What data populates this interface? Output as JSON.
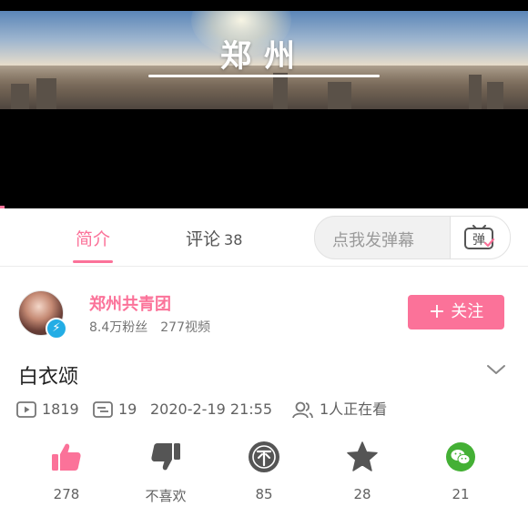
{
  "banner": {
    "title": "郑州"
  },
  "tabs": {
    "intro": "简介",
    "comments": "评论",
    "comments_count": "38"
  },
  "danmu": {
    "placeholder": "点我发弹幕",
    "button_glyph": "弹"
  },
  "uploader": {
    "name": "郑州共青团",
    "fans": "8.4万粉丝",
    "videos": "277视频",
    "follow_label": "关注",
    "follow_plus": "+"
  },
  "video": {
    "title": "白衣颂",
    "plays": "1819",
    "danmaku": "19",
    "date": "2020-2-19 21:55",
    "watching": "1人正在看"
  },
  "actions": [
    {
      "icon": "thumbs-up-icon",
      "label": "278",
      "color": "#fb7299"
    },
    {
      "icon": "thumbs-down-icon",
      "label": "不喜欢",
      "color": "#555555"
    },
    {
      "icon": "coin-icon",
      "label": "85",
      "color": "#555555"
    },
    {
      "icon": "star-icon",
      "label": "28",
      "color": "#555555"
    },
    {
      "icon": "wechat-icon",
      "label": "21",
      "color": "#44b035"
    }
  ],
  "colors": {
    "accent": "#fb7299",
    "badge": "#23ade5"
  }
}
